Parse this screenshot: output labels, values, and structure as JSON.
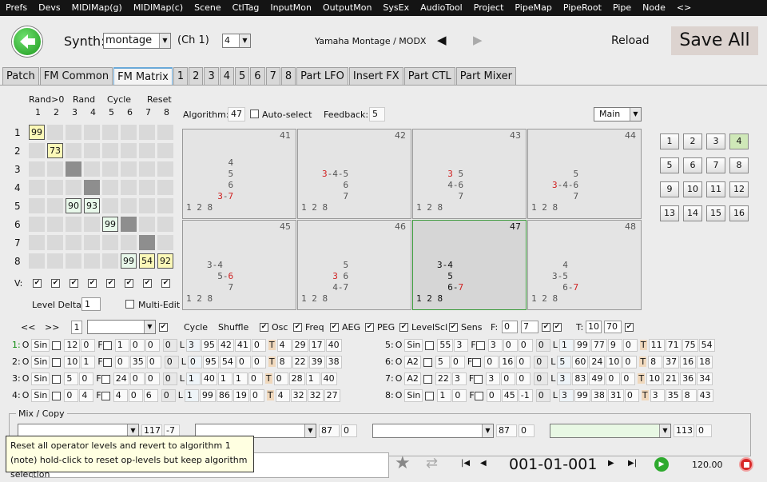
{
  "menu": [
    "Prefs",
    "Devs",
    "MIDIMap(g)",
    "MIDIMap(c)",
    "Scene",
    "CtlTag",
    "InputMon",
    "OutputMon",
    "SysEx",
    "AudioTool",
    "Project",
    "PipeMap",
    "PipeRoot",
    "Pipe",
    "Node",
    "<>"
  ],
  "header": {
    "synth_label": "Synth:",
    "synth_value": "montage",
    "channel": "(Ch 1)",
    "ch_select": "4",
    "device": "Yamaha Montage / MODX",
    "reload": "Reload",
    "save_all": "Save All"
  },
  "tabs": [
    "Patch",
    "FM Common",
    "FM Matrix",
    "1",
    "2",
    "3",
    "4",
    "5",
    "6",
    "7",
    "8",
    "Part LFO",
    "Insert FX",
    "Part CTL",
    "Part Mixer"
  ],
  "matrix": {
    "buttons": [
      "Rand>0",
      "Rand",
      "Cycle",
      "Reset"
    ],
    "cols": [
      "1",
      "2",
      "3",
      "4",
      "5",
      "6",
      "7",
      "8"
    ],
    "rows": [
      "1",
      "2",
      "3",
      "4",
      "5",
      "6",
      "7",
      "8"
    ],
    "v_label": "V:",
    "level_delta_label": "Level Delta:",
    "level_delta": "1",
    "multi_edit": "Multi-Edit",
    "values": [
      {
        "r": 0,
        "c": 0,
        "v": "99"
      },
      {
        "r": 1,
        "c": 1,
        "v": "73"
      },
      {
        "r": 4,
        "c": 2,
        "v": "90"
      },
      {
        "r": 4,
        "c": 3,
        "v": "93"
      },
      {
        "r": 5,
        "c": 4,
        "v": "99"
      },
      {
        "r": 7,
        "c": 5,
        "v": "99"
      },
      {
        "r": 7,
        "c": 6,
        "v": "54"
      },
      {
        "r": 7,
        "c": 7,
        "v": "92"
      }
    ]
  },
  "algo": {
    "label": "Algorithm:",
    "value": "47",
    "auto_select": "Auto-select",
    "feedback_label": "Feedback:",
    "feedback": "5",
    "view": "Main"
  },
  "algorithms": [
    {
      "n": "41",
      "lines": [
        "    4",
        "    5",
        "    6",
        "  3-7",
        "1 2 8"
      ]
    },
    {
      "n": "42",
      "lines": [
        "3-4-5",
        "    6",
        "    7",
        "1 2 8"
      ]
    },
    {
      "n": "43",
      "lines": [
        "  3 5",
        "  4-6",
        "    7",
        "1 2 8"
      ]
    },
    {
      "n": "44",
      "lines": [
        "    5",
        "3-4-6",
        "    7",
        "1 2 8"
      ]
    },
    {
      "n": "45",
      "lines": [
        "3-4",
        "  5-6",
        "    7",
        "1 2 8"
      ]
    },
    {
      "n": "46",
      "lines": [
        "    5",
        "  3 6",
        "  4-7",
        "1 2 8"
      ]
    },
    {
      "n": "47",
      "lines": [
        "3-4",
        "  5",
        "  6-7",
        "1 2 8"
      ]
    },
    {
      "n": "48",
      "lines": [
        "  4",
        "3-5",
        "  6-7",
        "1 2 8"
      ]
    }
  ],
  "numpad": [
    "1",
    "2",
    "3",
    "4",
    "5",
    "6",
    "7",
    "8",
    "9",
    "10",
    "11",
    "12",
    "13",
    "14",
    "15",
    "16"
  ],
  "ctrl": {
    "prev": "<<",
    "next": ">>",
    "page": "1",
    "cycle": "Cycle",
    "shuffle": "Shuffle",
    "osc": "Osc",
    "freq": "Freq",
    "aeg": "AEG",
    "peg": "PEG",
    "levelscl": "LevelScl",
    "sens": "Sens",
    "f_label": "F:",
    "f1": "0",
    "f2": "7",
    "t_label": "T:",
    "t1": "10",
    "t2": "70"
  },
  "operators": [
    {
      "id": "1:",
      "w": "Sin",
      "a": "12",
      "b": "0",
      "f": [
        "1",
        "0",
        "0"
      ],
      "z": "0",
      "l": [
        "3",
        "95",
        "42",
        "41",
        "0"
      ],
      "t": [
        "4",
        "29",
        "17",
        "40"
      ]
    },
    {
      "id": "2:",
      "w": "Sin",
      "a": "10",
      "b": "1",
      "f": [
        "0",
        "35",
        "0"
      ],
      "z": "0",
      "l": [
        "0",
        "95",
        "54",
        "0",
        "0"
      ],
      "t": [
        "8",
        "22",
        "39",
        "38"
      ]
    },
    {
      "id": "3:",
      "w": "Sin",
      "a": "5",
      "b": "0",
      "f": [
        "24",
        "0",
        "0"
      ],
      "z": "0",
      "l": [
        "1",
        "40",
        "1",
        "1",
        "0"
      ],
      "t": [
        "0",
        "28",
        "1",
        "40"
      ]
    },
    {
      "id": "4:",
      "w": "Sin",
      "a": "0",
      "b": "4",
      "f": [
        "4",
        "0",
        "6"
      ],
      "z": "0",
      "l": [
        "1",
        "99",
        "86",
        "19",
        "0"
      ],
      "t": [
        "4",
        "32",
        "32",
        "27"
      ]
    },
    {
      "id": "5:",
      "w": "Sin",
      "a": "55",
      "b": "3",
      "f": [
        "3",
        "0",
        "0"
      ],
      "z": "0",
      "l": [
        "1",
        "99",
        "77",
        "9",
        "0"
      ],
      "t": [
        "11",
        "71",
        "75",
        "54"
      ]
    },
    {
      "id": "6:",
      "w": "A2",
      "a": "5",
      "b": "0",
      "f": [
        "0",
        "16",
        "0"
      ],
      "z": "0",
      "l": [
        "5",
        "60",
        "24",
        "10",
        "0"
      ],
      "t": [
        "8",
        "37",
        "16",
        "18"
      ]
    },
    {
      "id": "7:",
      "w": "A2",
      "a": "22",
      "b": "3",
      "f": [
        "3",
        "0",
        "0"
      ],
      "z": "0",
      "l": [
        "3",
        "83",
        "49",
        "0",
        "0"
      ],
      "t": [
        "10",
        "21",
        "36",
        "34"
      ]
    },
    {
      "id": "8:",
      "w": "Sin",
      "a": "1",
      "b": "0",
      "f": [
        "0",
        "45",
        "-1"
      ],
      "z": "0",
      "l": [
        "3",
        "99",
        "38",
        "31",
        "0"
      ],
      "t": [
        "3",
        "35",
        "8",
        "43"
      ]
    }
  ],
  "mix": {
    "title": "Mix / Copy",
    "slots": [
      {
        "v1": "117",
        "v2": "-7"
      },
      {
        "v1": "87",
        "v2": "0"
      },
      {
        "v1": "87",
        "v2": "0"
      },
      {
        "v1": "113",
        "v2": "0"
      }
    ]
  },
  "tooltip": [
    "Reset all operator levels and revert to algorithm 1",
    "(note) hold-click to reset op-levels but keep algorithm selection"
  ],
  "transport": {
    "position": "001-01-001",
    "tempo": "120.00"
  }
}
